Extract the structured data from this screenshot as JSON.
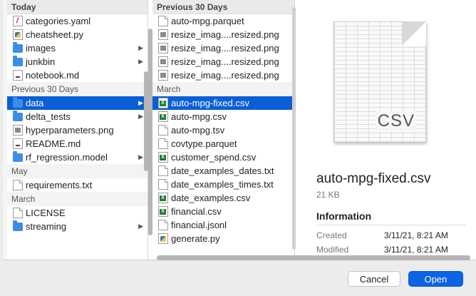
{
  "column1": {
    "sections": [
      {
        "title": "Today",
        "items": [
          {
            "label": "categories.yaml",
            "icon": "yaml-file-icon",
            "chevron": false,
            "selected": false
          },
          {
            "label": "cheatsheet.py",
            "icon": "python-file-icon",
            "chevron": false,
            "selected": false
          },
          {
            "label": "images",
            "icon": "folder-icon",
            "chevron": true,
            "selected": false
          },
          {
            "label": "junkbin",
            "icon": "folder-icon",
            "chevron": true,
            "selected": false
          },
          {
            "label": "notebook.md",
            "icon": "markdown-file-icon",
            "chevron": false,
            "selected": false
          }
        ]
      },
      {
        "title": "Previous 30 Days",
        "items": [
          {
            "label": "data",
            "icon": "folder-icon",
            "chevron": true,
            "selected": true
          },
          {
            "label": "delta_tests",
            "icon": "folder-icon",
            "chevron": true,
            "selected": false
          },
          {
            "label": "hyperparameters.png",
            "icon": "image-file-icon",
            "chevron": false,
            "selected": false
          },
          {
            "label": "README.md",
            "icon": "markdown-file-icon",
            "chevron": false,
            "selected": false
          },
          {
            "label": "rf_regression.model",
            "icon": "folder-icon",
            "chevron": true,
            "selected": false
          }
        ]
      },
      {
        "title": "May",
        "items": [
          {
            "label": "requirements.txt",
            "icon": "text-file-icon",
            "chevron": false,
            "selected": false
          }
        ]
      },
      {
        "title": "March",
        "items": [
          {
            "label": "LICENSE",
            "icon": "text-file-icon",
            "chevron": false,
            "selected": false
          },
          {
            "label": "streaming",
            "icon": "folder-icon",
            "chevron": true,
            "selected": false
          }
        ]
      }
    ]
  },
  "column2": {
    "sections": [
      {
        "title": "Previous 30 Days",
        "items": [
          {
            "label": "auto-mpg.parquet",
            "icon": "text-file-icon",
            "selected": false
          },
          {
            "label": "resize_imag....resized.png",
            "icon": "image-file-icon",
            "selected": false
          },
          {
            "label": "resize_imag....resized.png",
            "icon": "image-file-icon",
            "selected": false
          },
          {
            "label": "resize_imag....resized.png",
            "icon": "image-file-icon",
            "selected": false
          },
          {
            "label": "resize_imag....resized.png",
            "icon": "image-file-icon",
            "selected": false
          }
        ]
      },
      {
        "title": "March",
        "items": [
          {
            "label": "auto-mpg-fixed.csv",
            "icon": "csv-file-icon",
            "selected": true
          },
          {
            "label": "auto-mpg.csv",
            "icon": "csv-file-icon",
            "selected": false
          },
          {
            "label": "auto-mpg.tsv",
            "icon": "text-file-icon",
            "selected": false
          },
          {
            "label": "covtype.parquet",
            "icon": "text-file-icon",
            "selected": false
          },
          {
            "label": "customer_spend.csv",
            "icon": "csv-file-icon",
            "selected": false
          },
          {
            "label": "date_examples_dates.txt",
            "icon": "text-file-icon",
            "selected": false
          },
          {
            "label": "date_examples_times.txt",
            "icon": "text-file-icon",
            "selected": false
          },
          {
            "label": "date_examples.csv",
            "icon": "csv-file-icon",
            "selected": false
          },
          {
            "label": "financial.csv",
            "icon": "csv-file-icon",
            "selected": false
          },
          {
            "label": "financial.jsonl",
            "icon": "text-file-icon",
            "selected": false
          },
          {
            "label": "generate.py",
            "icon": "python-file-icon",
            "selected": false
          }
        ]
      }
    ]
  },
  "preview": {
    "thumbnail_tag": "CSV",
    "file_name": "auto-mpg-fixed.csv",
    "file_size": "21 KB",
    "info_heading": "Information",
    "rows": [
      {
        "label": "Created",
        "value": "3/11/21, 8:21 AM"
      },
      {
        "label": "Modified",
        "value": "3/11/21, 8:21 AM"
      }
    ]
  },
  "buttons": {
    "cancel": "Cancel",
    "open": "Open"
  },
  "colors": {
    "selection": "#0a5fd6",
    "primary_button": "#0b63e5",
    "folder": "#3b8ee8",
    "csv_badge": "#1f7a3a"
  }
}
